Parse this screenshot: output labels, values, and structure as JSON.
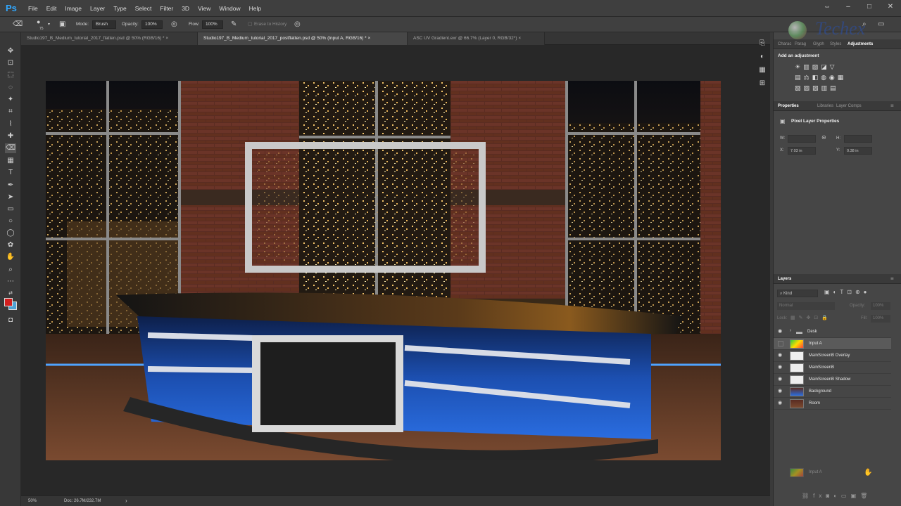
{
  "app": {
    "logo": "Ps"
  },
  "menu": [
    "File",
    "Edit",
    "Image",
    "Layer",
    "Type",
    "Select",
    "Filter",
    "3D",
    "View",
    "Window",
    "Help"
  ],
  "options": {
    "brush_size": "75",
    "mode_label": "Mode:",
    "mode_value": "Brush",
    "opacity_label": "Opacity:",
    "opacity_value": "100%",
    "flow_label": "Flow:",
    "flow_value": "100%",
    "erase_history": "Erase to History"
  },
  "tabs": [
    {
      "label": "Studio197_B_Medium_tutorial_2017_flatten.psd @ 50% (RGB/16) *",
      "active": false
    },
    {
      "label": "Studio197_B_Medium_tutorial_2017_postflatten.psd @ 50% (Input A, RGB/16) *",
      "active": true
    },
    {
      "label": "ASC UV Gradient.exr @ 66.7% (Layer 0, RGB/32*)",
      "active": false
    }
  ],
  "status": {
    "zoom": "50%",
    "doc": "Doc: 26.7M/232.7M"
  },
  "watermark": "Techex",
  "panel_top": {
    "tabs": [
      "Charac",
      "Parag",
      "Glyph",
      "Styles",
      "Adjustments"
    ],
    "add_adjustment": "Add an adjustment"
  },
  "properties": {
    "tabs": [
      "Properties",
      "Libraries",
      "Layer Comps"
    ],
    "heading": "Pixel Layer Properties",
    "w_label": "W:",
    "h_label": "H:",
    "x_label": "X:",
    "x_value": "7.03 in",
    "y_label": "Y:",
    "y_value": "0.38 in"
  },
  "layers_panel": {
    "title": "Layers",
    "filter": "Kind",
    "blend": "Normal",
    "opacity_label": "Opacity:",
    "opacity_value": "100%",
    "lock_label": "Lock:",
    "fill_label": "Fill:",
    "fill_value": "100%",
    "layers": [
      {
        "name": "Desk",
        "visible": true,
        "selected": false,
        "kind": "folder"
      },
      {
        "name": "Input A",
        "visible": false,
        "selected": true,
        "kind": "gradient"
      },
      {
        "name": "MainScreenB Overlay",
        "visible": true,
        "selected": false,
        "kind": "checker"
      },
      {
        "name": "MainScreenB",
        "visible": true,
        "selected": false,
        "kind": "checker"
      },
      {
        "name": "MainScreenB Shadow",
        "visible": true,
        "selected": false,
        "kind": "checker"
      },
      {
        "name": "Background",
        "visible": true,
        "selected": false,
        "kind": "room"
      },
      {
        "name": "Room",
        "visible": true,
        "selected": false,
        "kind": "room"
      }
    ],
    "drag_ghost": "Input A"
  }
}
